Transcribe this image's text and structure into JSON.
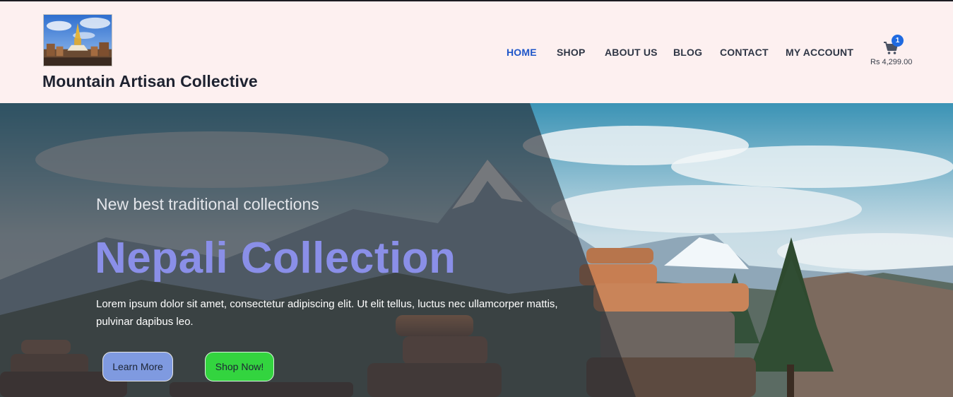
{
  "site": {
    "title": "Mountain Artisan Collective"
  },
  "nav": {
    "items": [
      {
        "label": "HOME",
        "active": true
      },
      {
        "label": "SHOP",
        "active": false
      },
      {
        "label": "ABOUT US",
        "active": false
      },
      {
        "label": "BLOG",
        "active": false
      },
      {
        "label": "CONTACT",
        "active": false
      },
      {
        "label": "MY ACCOUNT",
        "active": false
      }
    ]
  },
  "cart": {
    "icon": "cart-icon",
    "count": "1",
    "total": "Rs 4,299.00"
  },
  "hero": {
    "subtitle": "New best traditional collections",
    "title": "Nepali Collection",
    "text": "Lorem ipsum dolor sit amet, consectetur adipiscing elit. Ut elit tellus, luctus nec ullamcorper mattis, pulvinar dapibus leo.",
    "learn_more_label": "Learn More",
    "shop_now_label": "Shop Now!"
  },
  "colors": {
    "header_bg": "#fdf0f0",
    "nav_active": "#1f56c9",
    "nav_text": "#2f3645",
    "hero_title": "#8a8fe8",
    "learn_more_bg": "#7f9ae0",
    "shop_now_bg": "#33d43f",
    "badge_bg": "#1f6ae0"
  }
}
